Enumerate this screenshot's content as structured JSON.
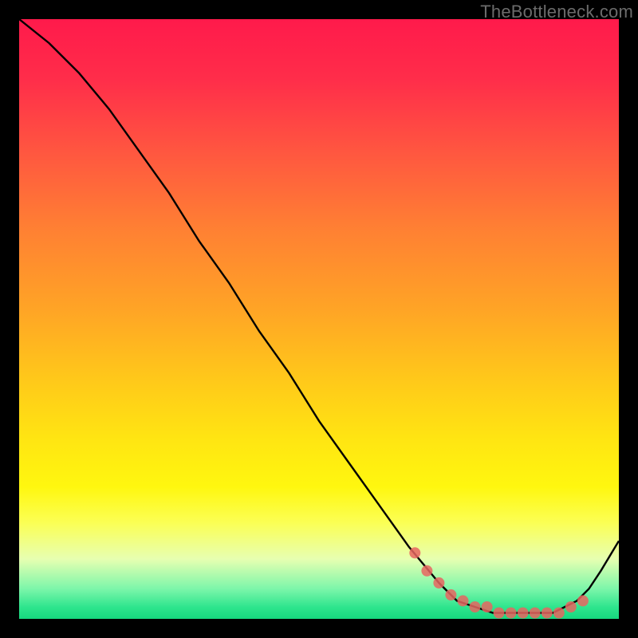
{
  "watermark": "TheBottleneck.com",
  "chart_data": {
    "type": "line",
    "title": "",
    "xlabel": "",
    "ylabel": "",
    "xlim": [
      0,
      100
    ],
    "ylim": [
      0,
      100
    ],
    "x": [
      0,
      5,
      10,
      15,
      20,
      25,
      30,
      35,
      40,
      45,
      50,
      55,
      60,
      65,
      70,
      73,
      76,
      79,
      81,
      83,
      85,
      87,
      89,
      91,
      93,
      95,
      97,
      100
    ],
    "y": [
      100,
      96,
      91,
      85,
      78,
      71,
      63,
      56,
      48,
      41,
      33,
      26,
      19,
      12,
      6,
      3,
      2,
      1,
      1,
      1,
      1,
      1,
      1,
      2,
      3,
      5,
      8,
      13
    ],
    "markers": {
      "x": [
        66,
        68,
        70,
        72,
        74,
        76,
        78,
        80,
        82,
        84,
        86,
        88,
        90,
        92,
        94
      ],
      "y": [
        11,
        8,
        6,
        4,
        3,
        2,
        2,
        1,
        1,
        1,
        1,
        1,
        1,
        2,
        3
      ]
    },
    "line_color": "#000000",
    "marker_color": "#e86560",
    "background_gradient": [
      "#ff1a4b",
      "#ffa326",
      "#fff70f",
      "#16d87f"
    ]
  }
}
